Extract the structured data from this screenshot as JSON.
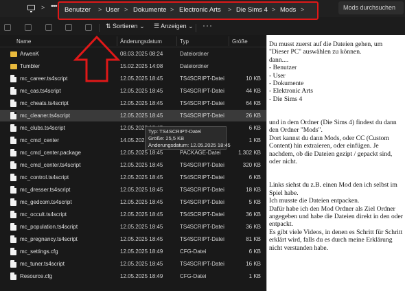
{
  "address_bar": {
    "crumbs": [
      "Benutzer",
      "User",
      "Dokumente",
      "Electronic Arts",
      "Die Sims 4",
      "Mods"
    ],
    "separator": ">",
    "search_placeholder": "Mods durchsuchen"
  },
  "toolbar": {
    "sort_label": "Sortieren",
    "view_label": "Anzeigen",
    "more_label": "···"
  },
  "table": {
    "headers": {
      "name": "Name",
      "date": "Änderungsdatum",
      "type": "Typ",
      "size": "Größe"
    },
    "rows": [
      {
        "icon": "folder",
        "name": "ArwenK",
        "date": "08.03.2025 08:24",
        "type": "Dateiordner",
        "size": ""
      },
      {
        "icon": "folder",
        "name": "Tumbler",
        "date": "15.02.2025 14:08",
        "type": "Dateiordner",
        "size": ""
      },
      {
        "icon": "file",
        "name": "mc_career.ts4script",
        "date": "12.05.2025 18:45",
        "type": "TS4SCRIPT-Datei",
        "size": "10 KB"
      },
      {
        "icon": "file",
        "name": "mc_cas.ts4script",
        "date": "12.05.2025 18:45",
        "type": "TS4SCRIPT-Datei",
        "size": "44 KB"
      },
      {
        "icon": "file",
        "name": "mc_cheats.ts4script",
        "date": "12.05.2025 18:45",
        "type": "TS4SCRIPT-Datei",
        "size": "64 KB"
      },
      {
        "icon": "file",
        "name": "mc_cleaner.ts4script",
        "date": "12.05.2025 18:45",
        "type": "TS4SCRIPT-Datei",
        "size": "26 KB",
        "selected": true
      },
      {
        "icon": "file",
        "name": "mc_clubs.ts4script",
        "date": "12.05.2025 18:45",
        "type": "",
        "size": "6 KB"
      },
      {
        "icon": "file",
        "name": "mc_cmd_center",
        "date": "14.05.2025 18:45",
        "type": "",
        "size": "1 KB"
      },
      {
        "icon": "file",
        "name": "mc_cmd_center.package",
        "date": "12.05.2025 18:45",
        "type": "PACKAGE-Datei",
        "size": "1.302 KB"
      },
      {
        "icon": "file",
        "name": "mc_cmd_center.ts4script",
        "date": "12.05.2025 18:45",
        "type": "TS4SCRIPT-Datei",
        "size": "320 KB"
      },
      {
        "icon": "file",
        "name": "mc_control.ts4script",
        "date": "12.05.2025 18:45",
        "type": "TS4SCRIPT-Datei",
        "size": "6 KB"
      },
      {
        "icon": "file",
        "name": "mc_dresser.ts4script",
        "date": "12.05.2025 18:45",
        "type": "TS4SCRIPT-Datei",
        "size": "18 KB"
      },
      {
        "icon": "file",
        "name": "mc_gedcom.ts4script",
        "date": "12.05.2025 18:45",
        "type": "TS4SCRIPT-Datei",
        "size": "5 KB"
      },
      {
        "icon": "file",
        "name": "mc_occult.ts4script",
        "date": "12.05.2025 18:45",
        "type": "TS4SCRIPT-Datei",
        "size": "36 KB"
      },
      {
        "icon": "file",
        "name": "mc_population.ts4script",
        "date": "12.05.2025 18:45",
        "type": "TS4SCRIPT-Datei",
        "size": "36 KB"
      },
      {
        "icon": "file",
        "name": "mc_pregnancy.ts4script",
        "date": "12.05.2025 18:45",
        "type": "TS4SCRIPT-Datei",
        "size": "81 KB"
      },
      {
        "icon": "file",
        "name": "mc_settings.cfg",
        "date": "12.05.2025 18:49",
        "type": "CFG-Datei",
        "size": "6 KB"
      },
      {
        "icon": "file",
        "name": "mc_tuner.ts4script",
        "date": "12.05.2025 18:45",
        "type": "TS4SCRIPT-Datei",
        "size": "16 KB"
      },
      {
        "icon": "file",
        "name": "Resource.cfg",
        "date": "12.05.2025 18:49",
        "type": "CFG-Datei",
        "size": "1 KB"
      }
    ]
  },
  "tooltip": {
    "line1": "Typ: TS4SCRIPT-Datei",
    "line2": "Größe: 25,5 KB",
    "line3": "Änderungsdatum: 12.05.2025 18:45"
  },
  "panel": {
    "text": "Du musst zuerst auf die Dateien gehen, um \"Dieser PC\" auswählen zu können.\ndann....\n- Benutzer\n- User\n- Dokumente\n- Elektronic Arts\n- Die Sims 4\n\n\nund in dem Ordner (Die Sims 4) findest du dann den Ordner \"Mods\".\nDort kannst du dann Mods, oder CC (Custom Content) hin extraieren, oder einfügen. Je nachdem, ob die Dateien gezipt / gepackt sind, oder nicht.\n\n\nLinks siehst du z.B. einen Mod den ich selbst im Spiel habe.\nIch musste die Dateien entpacken.\nDafür habe ich den Mod Ordner als Ziel Ordner angegeben und habe die Dateien direkt in den oder entpackt.\nEs gibt viele Videos, in denen es Schritt für Schritt erklärt wird, falls du es durch meine Erklärung nicht verstanden habe."
  },
  "colors": {
    "highlight_border": "#e01818",
    "arrow": "#e01818",
    "folder": "#e8b93c"
  }
}
